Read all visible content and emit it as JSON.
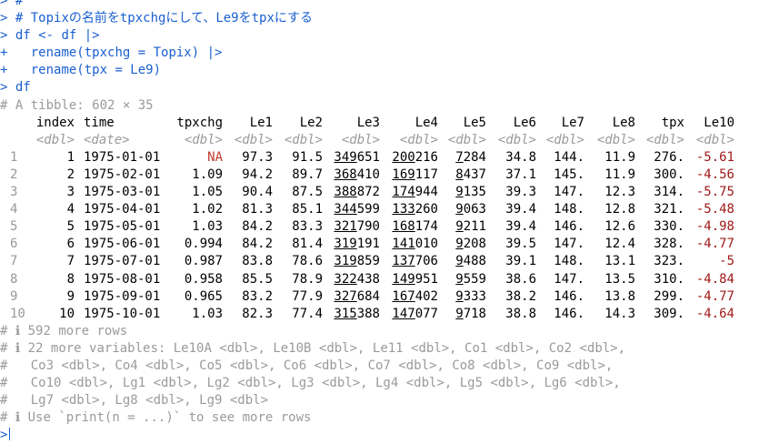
{
  "console": {
    "prompt_primary": ">",
    "prompt_continue": "+",
    "code_lines": [
      {
        "prompt": ">",
        "text": " #"
      },
      {
        "prompt": ">",
        "text": " # Topixの名前をtpxchgにして、Le9をtpxにする"
      },
      {
        "prompt": ">",
        "text": " df <- df |>"
      },
      {
        "prompt": "+",
        "text": "   rename(tpxchg = Topix) |>"
      },
      {
        "prompt": "+",
        "text": "   rename(tpx = Le9)"
      },
      {
        "prompt": ">",
        "text": " df"
      }
    ],
    "tibble_header": "# A tibble: 602 × 35",
    "columns": [
      {
        "name": "index",
        "type": "<dbl>"
      },
      {
        "name": "time",
        "type": "<date>"
      },
      {
        "name": "tpxchg",
        "type": "<dbl>"
      },
      {
        "name": "Le1",
        "type": "<dbl>"
      },
      {
        "name": "Le2",
        "type": "<dbl>"
      },
      {
        "name": "Le3",
        "type": "<dbl>"
      },
      {
        "name": "Le4",
        "type": "<dbl>"
      },
      {
        "name": "Le5",
        "type": "<dbl>"
      },
      {
        "name": "Le6",
        "type": "<dbl>"
      },
      {
        "name": "Le7",
        "type": "<dbl>"
      },
      {
        "name": "Le8",
        "type": "<dbl>"
      },
      {
        "name": "tpx",
        "type": "<dbl>"
      },
      {
        "name": "Le10",
        "type": "<dbl>"
      }
    ],
    "rows": [
      {
        "n": "1",
        "index": "1",
        "time": "1975-01-01",
        "tpxchg": "NA",
        "le1": "97.3",
        "le2": "91.5",
        "le3a": "349",
        "le3b": "651",
        "le4a": "200",
        "le4b": "216",
        "le5a": "7",
        "le5b": "284",
        "le6": "34.8",
        "le7": "144.",
        "le8": "11.9",
        "tpx": "276.",
        "le10": "-5.61"
      },
      {
        "n": "2",
        "index": "2",
        "time": "1975-02-01",
        "tpxchg": "1.09",
        "le1": "94.2",
        "le2": "89.7",
        "le3a": "368",
        "le3b": "410",
        "le4a": "169",
        "le4b": "117",
        "le5a": "8",
        "le5b": "437",
        "le6": "37.1",
        "le7": "145.",
        "le8": "11.9",
        "tpx": "300.",
        "le10": "-4.56"
      },
      {
        "n": "3",
        "index": "3",
        "time": "1975-03-01",
        "tpxchg": "1.05",
        "le1": "90.4",
        "le2": "87.5",
        "le3a": "388",
        "le3b": "872",
        "le4a": "174",
        "le4b": "944",
        "le5a": "9",
        "le5b": "135",
        "le6": "39.3",
        "le7": "147.",
        "le8": "12.3",
        "tpx": "314.",
        "le10": "-5.75"
      },
      {
        "n": "4",
        "index": "4",
        "time": "1975-04-01",
        "tpxchg": "1.02",
        "le1": "81.3",
        "le2": "85.1",
        "le3a": "344",
        "le3b": "599",
        "le4a": "133",
        "le4b": "260",
        "le5a": "9",
        "le5b": "063",
        "le6": "39.4",
        "le7": "148.",
        "le8": "12.8",
        "tpx": "321.",
        "le10": "-5.48"
      },
      {
        "n": "5",
        "index": "5",
        "time": "1975-05-01",
        "tpxchg": "1.03",
        "le1": "84.2",
        "le2": "83.3",
        "le3a": "321",
        "le3b": "790",
        "le4a": "168",
        "le4b": "174",
        "le5a": "9",
        "le5b": "211",
        "le6": "39.4",
        "le7": "146.",
        "le8": "12.6",
        "tpx": "330.",
        "le10": "-4.98"
      },
      {
        "n": "6",
        "index": "6",
        "time": "1975-06-01",
        "tpxchg": "0.994",
        "le1": "84.2",
        "le2": "81.4",
        "le3a": "319",
        "le3b": "191",
        "le4a": "141",
        "le4b": "010",
        "le5a": "9",
        "le5b": "208",
        "le6": "39.5",
        "le7": "147.",
        "le8": "12.4",
        "tpx": "328.",
        "le10": "-4.77"
      },
      {
        "n": "7",
        "index": "7",
        "time": "1975-07-01",
        "tpxchg": "0.987",
        "le1": "83.8",
        "le2": "78.6",
        "le3a": "319",
        "le3b": "859",
        "le4a": "137",
        "le4b": "706",
        "le5a": "9",
        "le5b": "488",
        "le6": "39.1",
        "le7": "148.",
        "le8": "13.1",
        "tpx": "323.",
        "le10": "-5"
      },
      {
        "n": "8",
        "index": "8",
        "time": "1975-08-01",
        "tpxchg": "0.958",
        "le1": "85.5",
        "le2": "78.9",
        "le3a": "322",
        "le3b": "438",
        "le4a": "149",
        "le4b": "951",
        "le5a": "9",
        "le5b": "559",
        "le6": "38.6",
        "le7": "147.",
        "le8": "13.5",
        "tpx": "310.",
        "le10": "-4.84"
      },
      {
        "n": "9",
        "index": "9",
        "time": "1975-09-01",
        "tpxchg": "0.965",
        "le1": "83.2",
        "le2": "77.9",
        "le3a": "327",
        "le3b": "684",
        "le4a": "167",
        "le4b": "402",
        "le5a": "9",
        "le5b": "333",
        "le6": "38.2",
        "le7": "146.",
        "le8": "13.8",
        "tpx": "299.",
        "le10": "-4.77"
      },
      {
        "n": "10",
        "index": "10",
        "time": "1975-10-01",
        "tpxchg": "1.03",
        "le1": "82.3",
        "le2": "77.4",
        "le3a": "315",
        "le3b": "388",
        "le4a": "147",
        "le4b": "077",
        "le5a": "9",
        "le5b": "718",
        "le6": "38.8",
        "le7": "146.",
        "le8": "14.3",
        "tpx": "309.",
        "le10": "-4.64"
      }
    ],
    "footer_lines": [
      "# ℹ 592 more rows",
      "# ℹ 22 more variables: Le10A <dbl>, Le10B <dbl>, Le11 <dbl>, Co1 <dbl>, Co2 <dbl>,",
      "#   Co3 <dbl>, Co4 <dbl>, Co5 <dbl>, Co6 <dbl>, Co7 <dbl>, Co8 <dbl>, Co9 <dbl>,",
      "#   Co10 <dbl>, Lg1 <dbl>, Lg2 <dbl>, Lg3 <dbl>, Lg4 <dbl>, Lg5 <dbl>, Lg6 <dbl>,",
      "#   Lg7 <dbl>, Lg8 <dbl>, Lg9 <dbl>",
      "# ℹ Use `print(n = ...)` to see more rows"
    ],
    "final_prompt": ">",
    "colors": {
      "code": "#1a5fd0",
      "dim": "#9a9a9a",
      "na": "#c0392b",
      "negative": "#a01818",
      "text": "#000000"
    }
  }
}
